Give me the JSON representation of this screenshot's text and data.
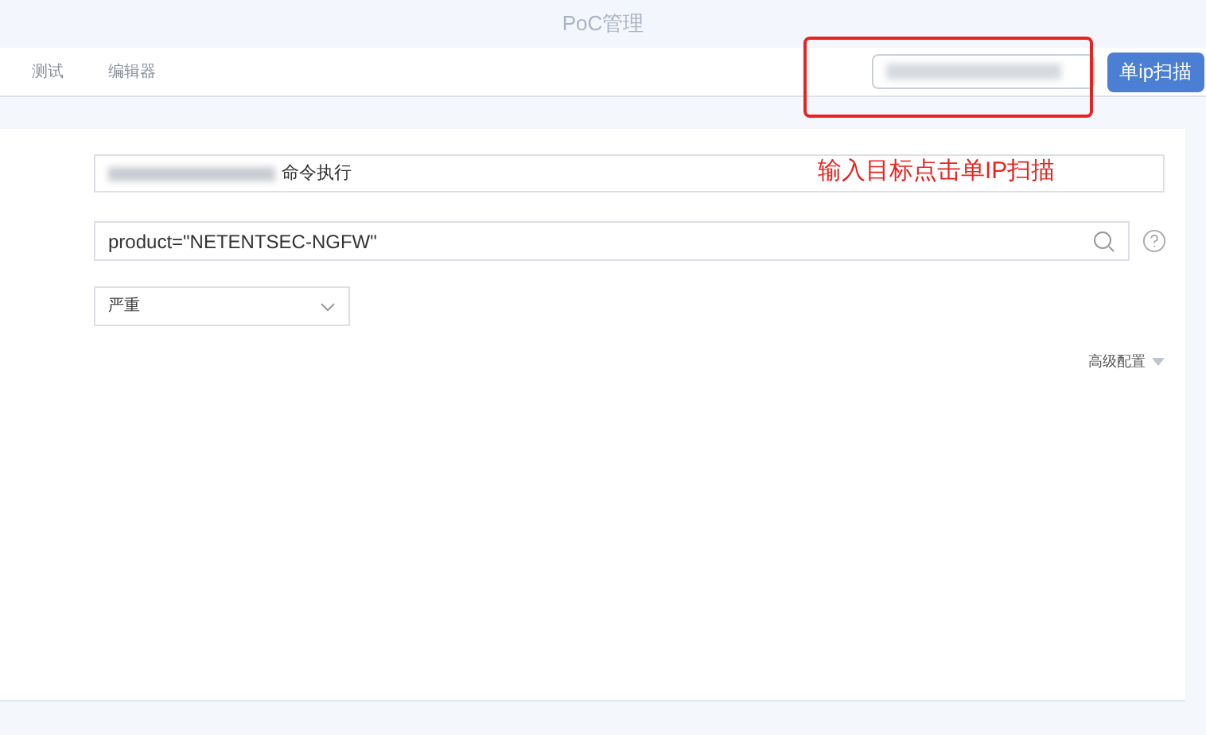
{
  "window": {
    "title": "PoC管理"
  },
  "tabs": [
    {
      "label": "测试",
      "selected": false
    },
    {
      "label": "编辑器",
      "selected": false
    }
  ],
  "scan_button": "单ip扫描",
  "annotation": "输入目标点击单IP扫描",
  "form": {
    "name_value": "命令执行",
    "query_value": "product=\"NETENTSEC-NGFW\"",
    "severity": "严重",
    "advanced": "高级配置"
  }
}
